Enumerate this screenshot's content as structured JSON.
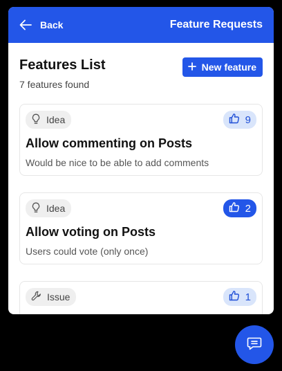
{
  "header": {
    "back_label": "Back",
    "title": "Feature Requests",
    "color": "#2356e8"
  },
  "list": {
    "title": "Features List",
    "count_text": "7 features found",
    "new_button_label": "New feature"
  },
  "features": [
    {
      "tag": "Idea",
      "tag_icon": "lightbulb-icon",
      "votes": "9",
      "voted": false,
      "title": "Allow commenting on Posts",
      "description": "Would be nice to be able to add comments"
    },
    {
      "tag": "Idea",
      "tag_icon": "lightbulb-icon",
      "votes": "2",
      "voted": true,
      "title": "Allow voting on Posts",
      "description": "Users could vote (only once)"
    },
    {
      "tag": "Issue",
      "tag_icon": "wrench-icon",
      "votes": "1",
      "voted": false,
      "title": "",
      "description": ""
    }
  ],
  "chat": {
    "icon": "chat-bubble-icon"
  }
}
